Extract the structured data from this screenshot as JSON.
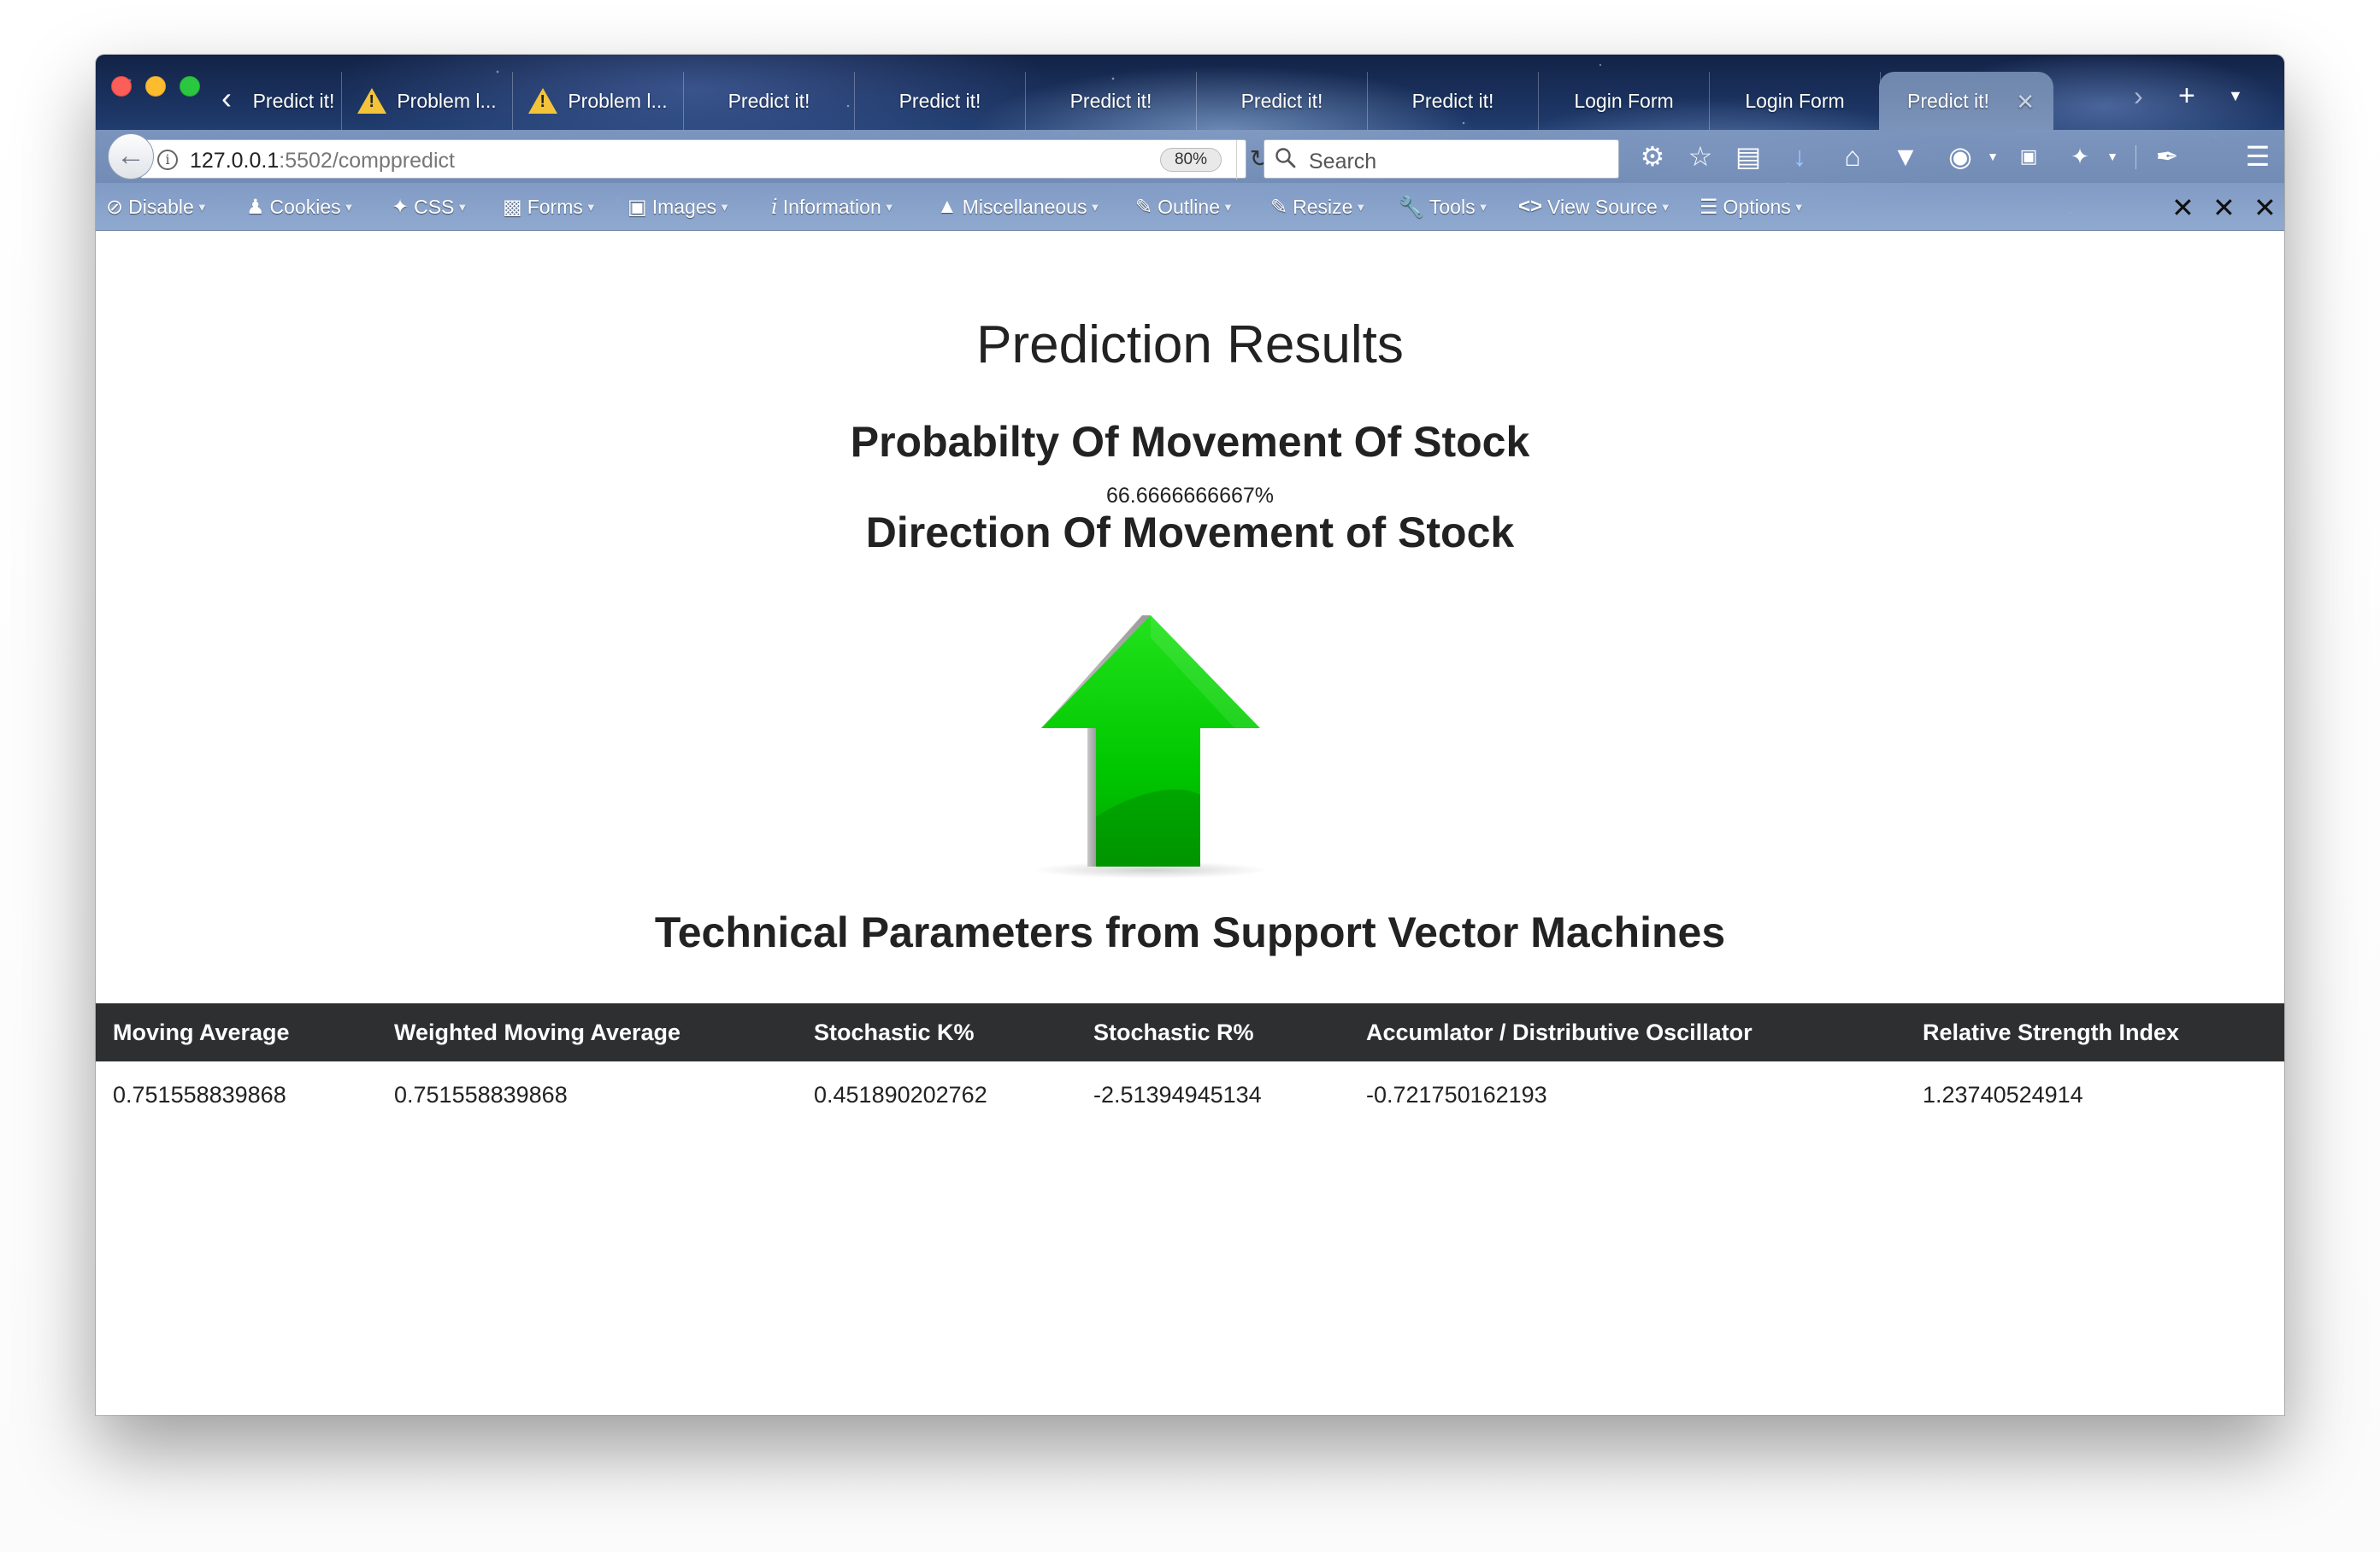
{
  "browser": {
    "tabs": [
      {
        "label": "Predict it!",
        "warning": false
      },
      {
        "label": "Problem l...",
        "warning": true
      },
      {
        "label": "Problem l...",
        "warning": true
      },
      {
        "label": "Predict it!",
        "warning": false
      },
      {
        "label": "Predict it!",
        "warning": false
      },
      {
        "label": "Predict it!",
        "warning": false
      },
      {
        "label": "Predict it!",
        "warning": false
      },
      {
        "label": "Predict it!",
        "warning": false
      },
      {
        "label": "Login Form",
        "warning": false
      },
      {
        "label": "Login Form",
        "warning": false
      },
      {
        "label": "Predict it!",
        "warning": false,
        "active": true
      }
    ],
    "url_host": "127.0.0.1",
    "url_rest": ":5502/comppredict",
    "zoom": "80%",
    "search_placeholder": "Search"
  },
  "devtoolbar": {
    "items": [
      "Disable",
      "Cookies",
      "CSS",
      "Forms",
      "Images",
      "Information",
      "Miscellaneous",
      "Outline",
      "Resize",
      "Tools",
      "View Source",
      "Options"
    ]
  },
  "page": {
    "title": "Prediction Results",
    "probability_heading": "Probabilty Of Movement Of Stock",
    "probability_value": "66.6666666667%",
    "direction_heading": "Direction Of Movement of Stock",
    "direction": "up",
    "params_heading": "Technical Parameters from Support Vector Machines",
    "table": {
      "headers": [
        "Moving Average",
        "Weighted Moving Average",
        "Stochastic K%",
        "Stochastic R%",
        "Accumlator / Distributive Oscillator",
        "Relative Strength Index"
      ],
      "rows": [
        [
          "0.751558839868",
          "0.751558839868",
          "0.451890202762",
          "-2.51394945134",
          "-0.721750162193",
          "1.23740524914"
        ]
      ]
    }
  },
  "colors": {
    "arrow_green": "#00c800",
    "table_header_bg": "#2e2f31"
  }
}
